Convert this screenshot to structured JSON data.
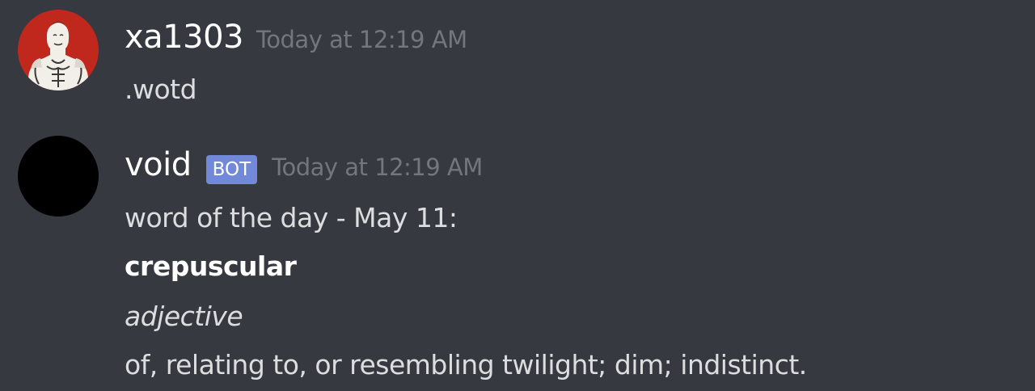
{
  "messages": [
    {
      "username": "xa1303",
      "timestamp": "Today at 12:19 AM",
      "avatar": "bodybuilder-portrait",
      "lines": [
        ".wotd"
      ]
    },
    {
      "username": "void",
      "badge": "BOT",
      "timestamp": "Today at 12:19 AM",
      "avatar": "black-circle",
      "lines": [
        "word of the day - May 11:",
        "crepuscular",
        "adjective",
        "of, relating to, or resembling twilight; dim; indistinct."
      ]
    }
  ],
  "colors": {
    "background": "#36393f",
    "username": "#ffffff",
    "timestamp": "#72767d",
    "text": "#dcddde",
    "bot_badge": "#7289da"
  }
}
